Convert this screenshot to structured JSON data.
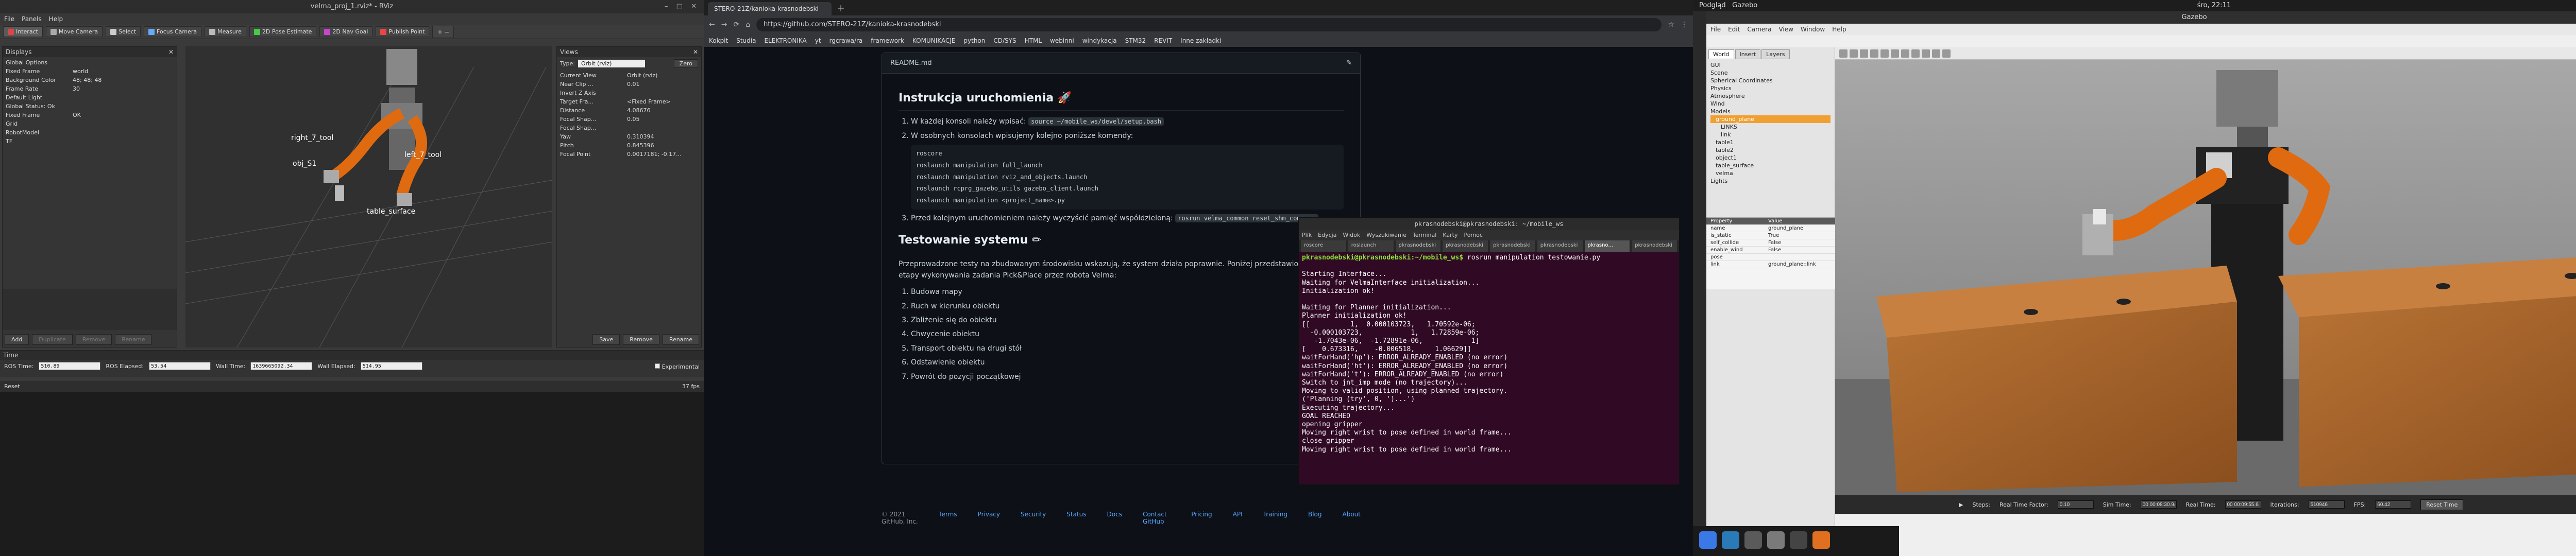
{
  "rviz": {
    "title": "velma_proj_1.rviz* - RViz",
    "menu": [
      "File",
      "Panels",
      "Help"
    ],
    "toolbar": [
      "Interact",
      "Move Camera",
      "Select",
      "Focus Camera",
      "Measure",
      "2D Pose Estimate",
      "2D Nav Goal",
      "Publish Point"
    ],
    "displays_title": "Displays",
    "displays": [
      {
        "k": "Global Options",
        "v": ""
      },
      {
        "k": "Fixed Frame",
        "v": "world"
      },
      {
        "k": "Background Color",
        "v": "48; 48; 48"
      },
      {
        "k": "Frame Rate",
        "v": "30"
      },
      {
        "k": "Default Light",
        "v": ""
      },
      {
        "k": "Global Status: Ok",
        "v": ""
      },
      {
        "k": "Fixed Frame",
        "v": "OK"
      },
      {
        "k": "Grid",
        "v": ""
      },
      {
        "k": "RobotModel",
        "v": ""
      },
      {
        "k": "TF",
        "v": ""
      }
    ],
    "displays_buttons": {
      "add": "Add",
      "duplicate": "Duplicate",
      "remove": "Remove",
      "rename": "Rename"
    },
    "views_title": "Views",
    "views_type_label": "Type:",
    "views_type_value": "Orbit (rviz)",
    "views_zero": "Zero",
    "views": [
      {
        "k": "Current View",
        "v": "Orbit (rviz)"
      },
      {
        "k": "Near Clip ...",
        "v": "0.01"
      },
      {
        "k": "Invert Z Axis",
        "v": ""
      },
      {
        "k": "Target Fra...",
        "v": "<Fixed Frame>"
      },
      {
        "k": "Distance",
        "v": "4.08676"
      },
      {
        "k": "Focal Shap...",
        "v": "0.05"
      },
      {
        "k": "Focal Shap...",
        "v": ""
      },
      {
        "k": "Yaw",
        "v": "0.310394"
      },
      {
        "k": "Pitch",
        "v": "0.845396"
      },
      {
        "k": "Focal Point",
        "v": "0.0017181; -0.17..."
      }
    ],
    "views_buttons": {
      "save": "Save",
      "remove": "Remove",
      "rename": "Rename"
    },
    "scene_labels": {
      "right": "right_7_tool",
      "obj": "obj_S1",
      "left": "left_7_tool",
      "table": "table_surface"
    },
    "time": {
      "title": "Time",
      "ros_time_label": "ROS Time:",
      "ros_time": "510.89",
      "ros_elapsed_label": "ROS Elapsed:",
      "ros_elapsed": "53.54",
      "wall_time_label": "Wall Time:",
      "wall_time": "1639665092.34",
      "wall_elapsed_label": "Wall Elapsed:",
      "wall_elapsed": "514.95",
      "experimental": "Experimental"
    },
    "status": {
      "reset": "Reset",
      "fps": "37 fps"
    }
  },
  "chrome": {
    "tab": "STERO-21Z/kanioka-krasnodebski",
    "url": "https://github.com/STERO-21Z/kanioka-krasnodebski",
    "bookmarks": [
      "Kokpit",
      "Studia",
      "ELEKTRONIKA",
      "yt",
      "rgcrawa/ra",
      "framework",
      "KOMUNIKACJE",
      "python",
      "CD/SYS",
      "HTML",
      "webinni",
      "windykacja",
      "STM32",
      "REVIT",
      "Inne zakładki"
    ],
    "readme_title": "README.md",
    "h_instr": "Instrukcja uruchomienia",
    "instr": [
      {
        "text": "W każdej konsoli należy wpisać:",
        "code": "source ~/mobile_ws/devel/setup.bash"
      },
      {
        "text": "W osobnych konsolach wpisujemy kolejno poniższe komendy:",
        "code": ""
      },
      {
        "text": "Przed kolejnym uruchomieniem należy wyczyścić pamięć współdzieloną:",
        "code": "rosrun velma_common reset_shm_comm.py"
      }
    ],
    "commands": [
      "roscore",
      "roslaunch manipulation full_launch",
      "roslaunch manipulation rviz_and_objects.launch",
      "roslaunch rcprg_gazebo_utils gazebo_client.launch",
      "roslaunch manipulation <project_name>.py"
    ],
    "h_test": "Testowanie systemu",
    "test_intro": "Przeprowadzone testy na zbudowanym środowisku wskazują, że system działa poprawnie. Poniżej przedstawiono kolejne etapy wykonywania zadania Pick&Place przez robota Velma:",
    "steps": [
      "Budowa mapy",
      "Ruch w kierunku obiektu",
      "Zbliżenie się do obiektu",
      "Chwycenie obiektu",
      "Transport obiektu na drugi stół",
      "Odstawienie obiektu",
      "Powrót do pozycji początkowej"
    ],
    "footer": [
      "© 2021 GitHub, Inc.",
      "Terms",
      "Privacy",
      "Security",
      "Status",
      "Docs",
      "Contact GitHub",
      "Pricing",
      "API",
      "Training",
      "Blog",
      "About"
    ]
  },
  "terminal": {
    "title": "pkrasnodebski@pkrasnodebski: ~/mobile_ws",
    "menu": [
      "Plik",
      "Edycja",
      "Widok",
      "Wyszukiwanie",
      "Terminal",
      "Karty",
      "Pomoc"
    ],
    "tabs": [
      "roscore",
      "roslaunch",
      "pkrasnodebski",
      "pkrasnodebski",
      "pkrasnodebski",
      "pkrasnodebski",
      "pkrasno...",
      "pkrasnodebski"
    ],
    "prompt": "pkrasnodebski@pkrasnodebski:~/mobile_ws$",
    "command": " rosrun manipulation testowanie.py",
    "lines": [
      "Starting Interface...",
      "Waiting for VelmaInterface initialization...",
      "Initialization ok!",
      "",
      "Waiting for Planner initialization...",
      "Planner initialization ok!",
      "[[          1,  0.000103723,   1.70592e-06;",
      "  -0.000103723,            1,   1.72859e-06;",
      "   -1.7043e-06,  -1.72891e-06,            1]",
      "[    0.673316,    -0.006518,     1.06629]]",
      "waitForHand('hp'): ERROR_ALREADY_ENABLED (no error)",
      "waitForHand('ht'): ERROR_ALREADY_ENABLED (no error)",
      "waitForHand('t'): ERROR_ALREADY_ENABLED (no error)",
      "Switch to jnt_imp mode (no trajectory)...",
      "Moving to valid position, using planned trajectory.",
      "('Planning (try', 0, ')...')",
      "Executing trajectory...",
      "GOAL REACHED",
      "opening gripper",
      "Moving right wrist to pose defined in world frame...",
      "close gripper",
      "Moving right wrist to pose defined in world frame..."
    ]
  },
  "gazebo": {
    "ubuntu_left": "Podgląd",
    "ubuntu_app": "Gazebo",
    "ubuntu_clock": "śro, 22:11",
    "title": "Gazebo",
    "menu": [
      "File",
      "Edit",
      "Camera",
      "View",
      "Window",
      "Help"
    ],
    "tabs": [
      "World",
      "Insert",
      "Layers"
    ],
    "tree": [
      "GUI",
      "Scene",
      "Spherical Coordinates",
      "Physics",
      "Atmosphere",
      "Wind",
      "Models",
      "ground_plane",
      "LINKS",
      "link",
      "table1",
      "table2",
      "object1",
      "table_surface",
      "velma",
      "Lights"
    ],
    "props_header": [
      "Property",
      "Value"
    ],
    "props": [
      {
        "k": "name",
        "v": "ground_plane"
      },
      {
        "k": "is_static",
        "v": "True"
      },
      {
        "k": "self_collide",
        "v": "False"
      },
      {
        "k": "enable_wind",
        "v": "False"
      },
      {
        "k": "pose",
        "v": ""
      },
      {
        "k": "link",
        "v": "ground_plane::link"
      }
    ],
    "bottom": {
      "steps": "Steps:",
      "rtf_label": "Real Time Factor:",
      "rtf": "0.10",
      "sim_label": "Sim Time:",
      "sim": "00 00:08:30.946",
      "real_label": "Real Time:",
      "real": "00 00:09:55.648",
      "iter_label": "Iterations:",
      "iter": "510946",
      "fps_label": "FPS:",
      "fps": "60.42",
      "reset": "Reset Time"
    }
  },
  "colors": {
    "robot_orange": "#e06a10",
    "table_wood": "#a0612a",
    "terminal_bg": "#300a24",
    "gh_bg": "#0d1117"
  }
}
